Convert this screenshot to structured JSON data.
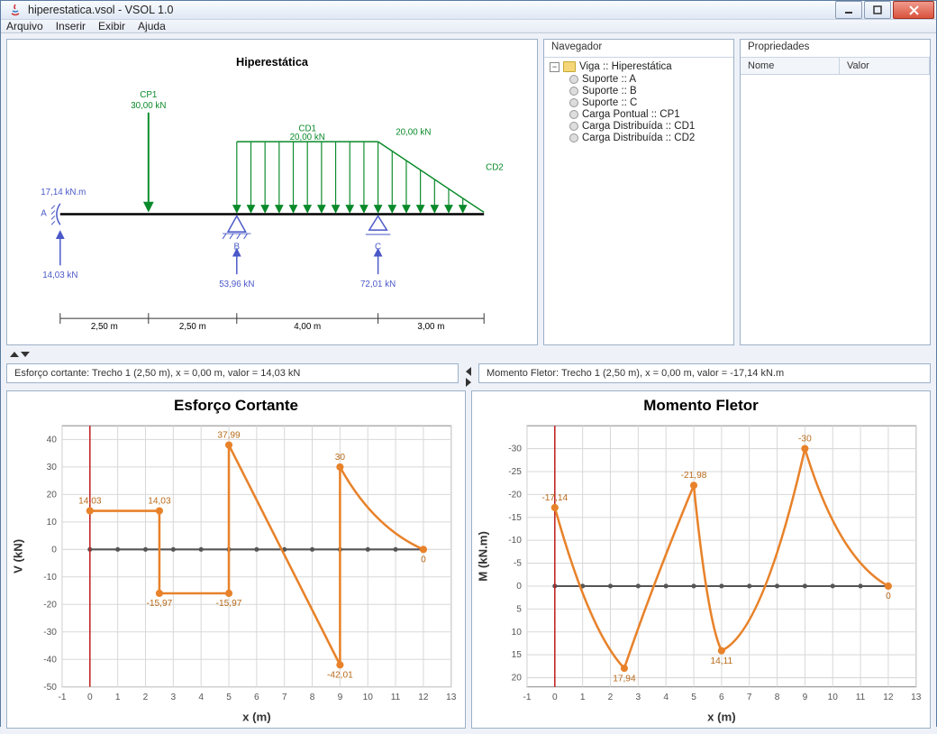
{
  "window": {
    "title": "hiperestatica.vsol - VSOL 1.0"
  },
  "menu": {
    "arquivo": "Arquivo",
    "inserir": "Inserir",
    "exibir": "Exibir",
    "ajuda": "Ajuda"
  },
  "navigator": {
    "header": "Navegador",
    "root": "Viga :: Hiperestática",
    "items": [
      "Suporte :: A",
      "Suporte :: B",
      "Suporte :: C",
      "Carga Pontual :: CP1",
      "Carga Distribuída :: CD1",
      "Carga Distribuída :: CD2"
    ]
  },
  "props": {
    "header": "Propriedades",
    "col_name": "Nome",
    "col_value": "Valor"
  },
  "beam": {
    "title": "Hiperestática",
    "moment_a": "17,14 kN.m",
    "reaction_a": "14,03 kN",
    "reaction_b": "53,96 kN",
    "reaction_c": "72,01 kN",
    "cp1_name": "CP1",
    "cp1_val": "30,00 kN",
    "cd1_name": "CD1",
    "cd1_val": "20,00 kN",
    "cd2_name": "CD2",
    "cd2_right_val": "20,00 kN",
    "sup_a": "A",
    "sup_b": "B",
    "sup_c": "C",
    "span1": "2,50 m",
    "span2": "2,50 m",
    "span3": "4,00 m",
    "span4": "3,00 m"
  },
  "strip": {
    "shear": "Esforço cortante:  Trecho 1 (2,50 m), x = 0,00 m, valor = 14,03 kN",
    "moment": "Momento Fletor:  Trecho 1 (2,50 m), x = 0,00 m, valor = -17,14 kN.m"
  },
  "charts": {
    "shear_title": "Esforço Cortante",
    "moment_title": "Momento Fletor"
  },
  "chart_data": [
    {
      "type": "line",
      "title": "Esforço Cortante",
      "xlabel": "x (m)",
      "ylabel": "V (kN)",
      "xlim": [
        -1,
        13
      ],
      "ylim": [
        -50,
        45
      ],
      "x_ticks": [
        -1,
        0,
        1,
        2,
        3,
        4,
        5,
        6,
        7,
        8,
        9,
        10,
        11,
        12,
        13
      ],
      "y_ticks": [
        -50,
        -40,
        -30,
        -20,
        -10,
        0,
        10,
        20,
        30,
        40
      ],
      "series": [
        {
          "name": "V",
          "segments": [
            [
              [
                0,
                14.03
              ],
              [
                2.5,
                14.03
              ]
            ],
            [
              [
                2.5,
                14.03
              ],
              [
                2.5,
                -15.97
              ]
            ],
            [
              [
                2.5,
                -15.97
              ],
              [
                5,
                -15.97
              ]
            ],
            [
              [
                5,
                -15.97
              ],
              [
                5,
                37.99
              ]
            ],
            [
              [
                5,
                37.99
              ],
              [
                9,
                -42.01
              ]
            ],
            [
              [
                9,
                -42.01
              ],
              [
                9,
                30
              ]
            ],
            [
              [
                9,
                30
              ],
              [
                12,
                0
              ]
            ]
          ],
          "labeled_points": [
            {
              "x": 0,
              "y": 14.03,
              "label": "14,03"
            },
            {
              "x": 2.5,
              "y": 14.03,
              "label": "14,03"
            },
            {
              "x": 2.5,
              "y": -15.97,
              "label": "-15,97"
            },
            {
              "x": 5,
              "y": -15.97,
              "label": "-15,97"
            },
            {
              "x": 5,
              "y": 37.99,
              "label": "37,99"
            },
            {
              "x": 9,
              "y": -42.01,
              "label": "-42,01"
            },
            {
              "x": 9,
              "y": 30,
              "label": "30"
            },
            {
              "x": 12,
              "y": 0,
              "label": "0"
            }
          ]
        }
      ]
    },
    {
      "type": "line",
      "title": "Momento Fletor",
      "xlabel": "x (m)",
      "ylabel": "M (kN.m)",
      "xlim": [
        -1,
        13
      ],
      "ylim_inverted": [
        -35,
        22
      ],
      "x_ticks": [
        -1,
        0,
        1,
        2,
        3,
        4,
        5,
        6,
        7,
        8,
        9,
        10,
        11,
        12,
        13
      ],
      "y_ticks": [
        -30,
        -25,
        -20,
        -15,
        -10,
        -5,
        0,
        5,
        10,
        15,
        20
      ],
      "series": [
        {
          "name": "M",
          "x": [
            0,
            2.5,
            5,
            6,
            9,
            12
          ],
          "y": [
            -17.14,
            17.94,
            -21.98,
            14.11,
            -30,
            0
          ],
          "labeled_points": [
            {
              "x": 0,
              "y": -17.14,
              "label": "-17,14"
            },
            {
              "x": 2.5,
              "y": 17.94,
              "label": "17,94"
            },
            {
              "x": 5,
              "y": -21.98,
              "label": "-21,98"
            },
            {
              "x": 6,
              "y": 14.11,
              "label": "14,11"
            },
            {
              "x": 9,
              "y": -30,
              "label": "-30"
            },
            {
              "x": 12,
              "y": 0,
              "label": "0"
            }
          ]
        }
      ]
    }
  ]
}
